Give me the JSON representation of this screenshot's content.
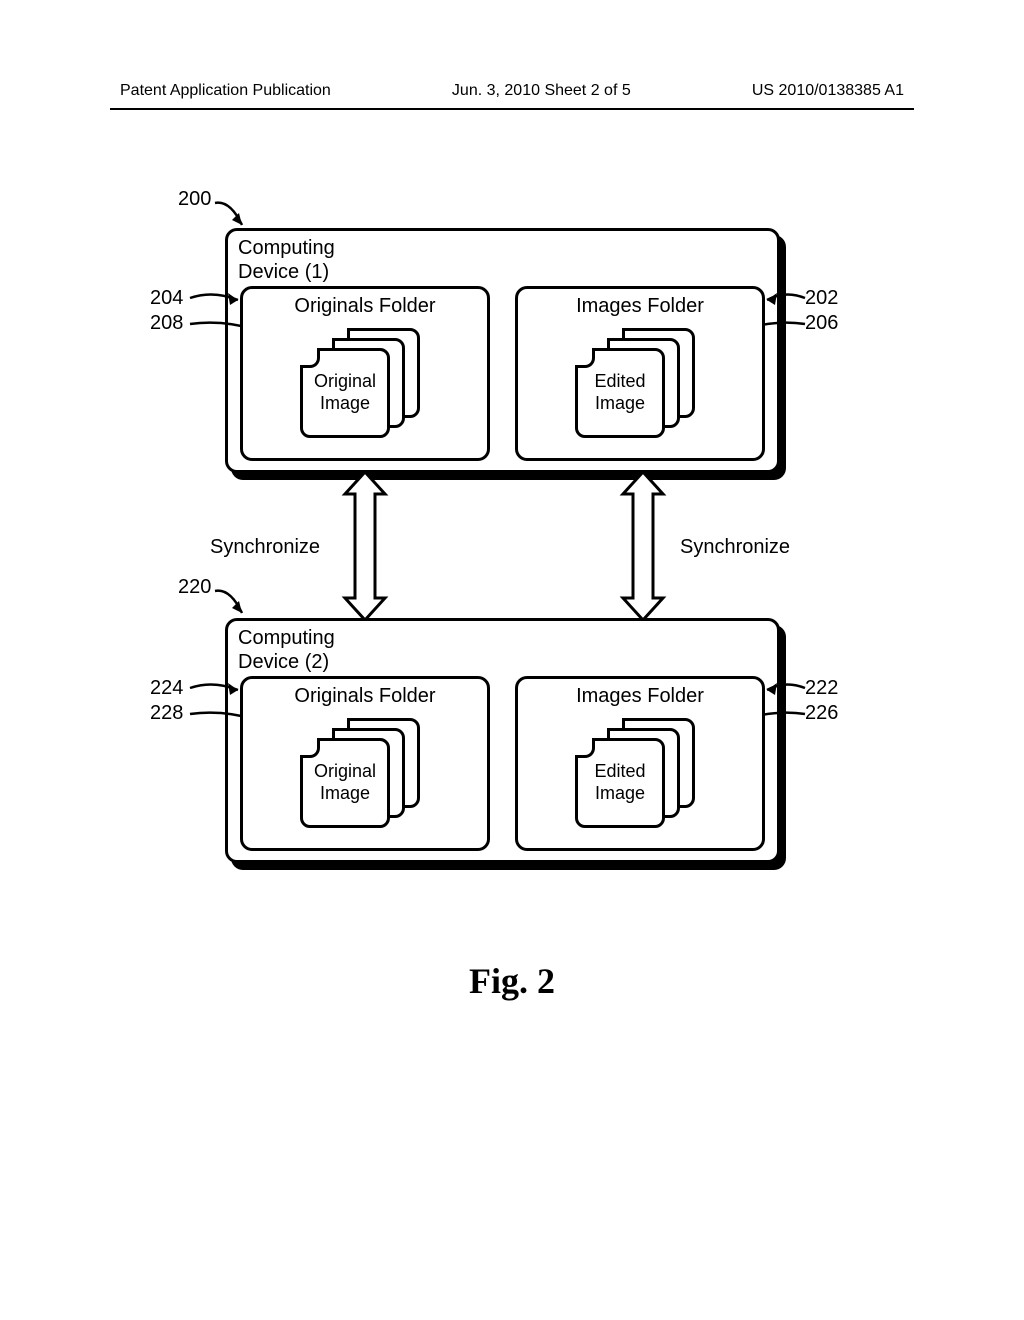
{
  "header": {
    "left": "Patent Application Publication",
    "center": "Jun. 3, 2010  Sheet 2 of 5",
    "right": "US 2010/0138385 A1"
  },
  "refs": {
    "r200": "200",
    "r204": "204",
    "r208": "208",
    "r202": "202",
    "r206": "206",
    "r220": "220",
    "r224": "224",
    "r228": "228",
    "r222": "222",
    "r226": "226"
  },
  "labels": {
    "device1": "Computing\nDevice (1)",
    "device2": "Computing\nDevice (2)",
    "originals_folder": "Originals Folder",
    "images_folder": "Images Folder",
    "original_image": "Original\nImage",
    "edited_image": "Edited\nImage",
    "synchronize": "Synchronize"
  },
  "caption": "Fig. 2"
}
